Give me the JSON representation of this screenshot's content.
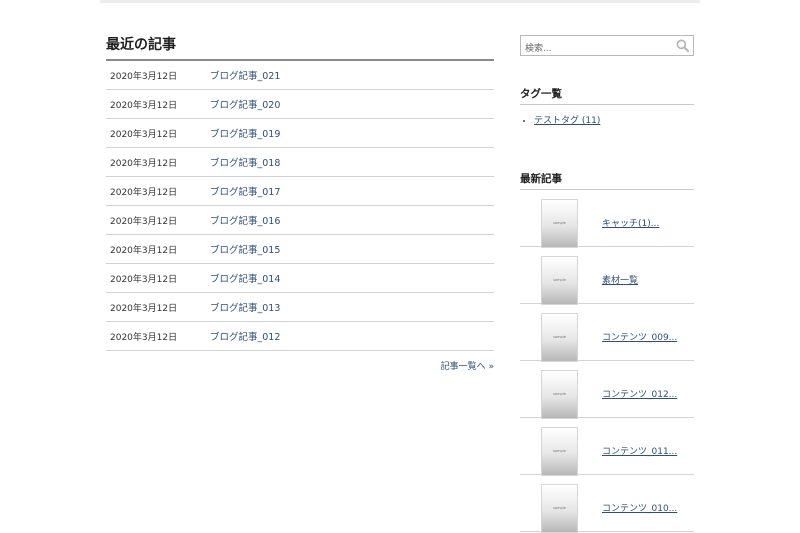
{
  "main": {
    "title": "最近の記事",
    "posts": [
      {
        "date": "2020年3月12日",
        "title": "ブログ記事_021"
      },
      {
        "date": "2020年3月12日",
        "title": "ブログ記事_020"
      },
      {
        "date": "2020年3月12日",
        "title": "ブログ記事_019"
      },
      {
        "date": "2020年3月12日",
        "title": "ブログ記事_018"
      },
      {
        "date": "2020年3月12日",
        "title": "ブログ記事_017"
      },
      {
        "date": "2020年3月12日",
        "title": "ブログ記事_016"
      },
      {
        "date": "2020年3月12日",
        "title": "ブログ記事_015"
      },
      {
        "date": "2020年3月12日",
        "title": "ブログ記事_014"
      },
      {
        "date": "2020年3月12日",
        "title": "ブログ記事_013"
      },
      {
        "date": "2020年3月12日",
        "title": "ブログ記事_012"
      }
    ],
    "more_label": "記事一覧へ »"
  },
  "sidebar": {
    "search": {
      "placeholder": "検索..."
    },
    "tags": {
      "title": "タグ一覧",
      "items": [
        {
          "label": "テストタグ (11)"
        }
      ]
    },
    "recent": {
      "title": "最新記事",
      "thumb_label": "sample",
      "items": [
        {
          "label": "キャッチ(1)..."
        },
        {
          "label": "素材一覧"
        },
        {
          "label": "コンテンツ_009..."
        },
        {
          "label": "コンテンツ_012..."
        },
        {
          "label": "コンテンツ_011..."
        },
        {
          "label": "コンテンツ_010..."
        }
      ]
    }
  }
}
